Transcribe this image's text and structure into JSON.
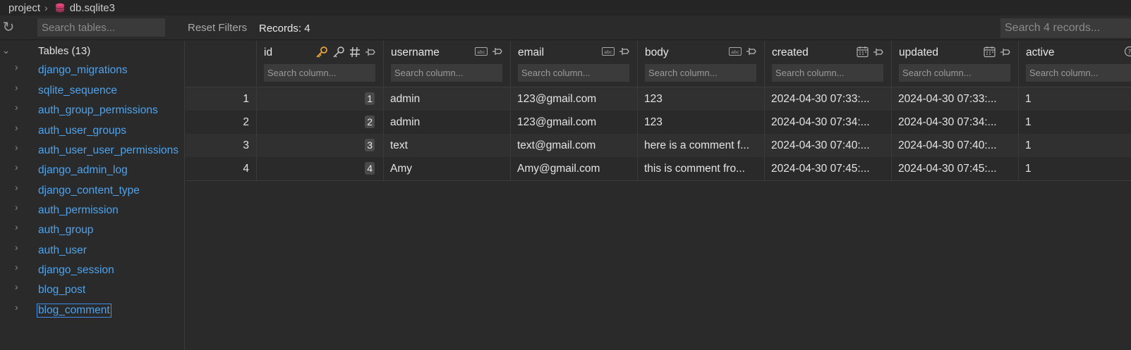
{
  "breadcrumb": {
    "project": "project",
    "file": "db.sqlite3"
  },
  "toolbar": {
    "search_tables_placeholder": "Search tables...",
    "reset_filters": "Reset Filters",
    "records": "Records: 4",
    "search_records_placeholder": "Search 4 records..."
  },
  "sidebar": {
    "header": "Tables (13)",
    "items": [
      {
        "label": "django_migrations"
      },
      {
        "label": "sqlite_sequence"
      },
      {
        "label": "auth_group_permissions"
      },
      {
        "label": "auth_user_groups"
      },
      {
        "label": "auth_user_user_permissions"
      },
      {
        "label": "django_admin_log"
      },
      {
        "label": "django_content_type"
      },
      {
        "label": "auth_permission"
      },
      {
        "label": "auth_group"
      },
      {
        "label": "auth_user"
      },
      {
        "label": "django_session"
      },
      {
        "label": "blog_post"
      },
      {
        "label": "blog_comment"
      }
    ],
    "selected": "blog_comment"
  },
  "columns": [
    {
      "name": "id",
      "placeholder": "Search column..."
    },
    {
      "name": "username",
      "placeholder": "Search column..."
    },
    {
      "name": "email",
      "placeholder": "Search column..."
    },
    {
      "name": "body",
      "placeholder": "Search column..."
    },
    {
      "name": "created",
      "placeholder": "Search column..."
    },
    {
      "name": "updated",
      "placeholder": "Search column..."
    },
    {
      "name": "active",
      "placeholder": "Search column..."
    }
  ],
  "rows": [
    {
      "num": "1",
      "id": "1",
      "username": "admin",
      "email": "123@gmail.com",
      "body": "123",
      "created": "2024-04-30 07:33:...",
      "updated": "2024-04-30 07:33:...",
      "active": "1"
    },
    {
      "num": "2",
      "id": "2",
      "username": "admin",
      "email": "123@gmail.com",
      "body": "123",
      "created": "2024-04-30 07:34:...",
      "updated": "2024-04-30 07:34:...",
      "active": "1"
    },
    {
      "num": "3",
      "id": "3",
      "username": "text",
      "email": "text@gmail.com",
      "body": "here is a comment f...",
      "created": "2024-04-30 07:40:...",
      "updated": "2024-04-30 07:40:...",
      "active": "1"
    },
    {
      "num": "4",
      "id": "4",
      "username": "Amy",
      "email": "Amy@gmail.com",
      "body": "this is comment fro...",
      "created": "2024-04-30 07:45:...",
      "updated": "2024-04-30 07:45:...",
      "active": "1"
    }
  ],
  "colors": {
    "link": "#4da3ee",
    "accent_key": "#e8a33a",
    "db_icon": "#e0457b"
  }
}
